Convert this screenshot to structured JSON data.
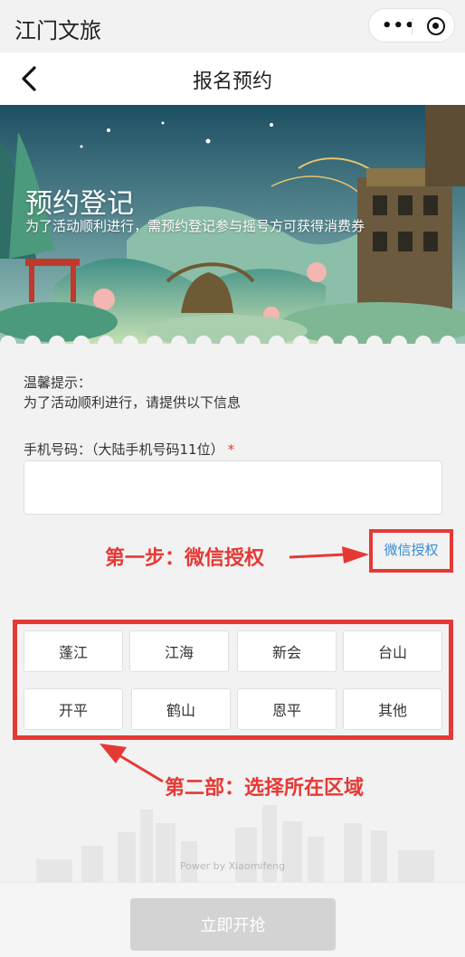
{
  "topbar": {
    "app_title": "江门文旅",
    "more_icon": "more-dots-icon",
    "close_icon": "target-icon"
  },
  "navbar": {
    "back_icon": "chevron-left-icon",
    "title": "报名预约"
  },
  "banner": {
    "title": "预约登记",
    "subtitle": "为了活动顺利进行，需预约登记参与摇号方可获得消费券"
  },
  "form": {
    "tip_title": "温馨提示：",
    "tip_text": "为了活动顺利进行，请提供以下信息",
    "phone_label": "手机号码：（大陆手机号码11位）",
    "required_mark": "*",
    "phone_value": "",
    "wechat_auth": "微信授权"
  },
  "annotations": {
    "step1": "第一步：微信授权",
    "step2": "第二部：选择所在区域"
  },
  "regions": [
    "蓬江",
    "江海",
    "新会",
    "台山",
    "开平",
    "鹤山",
    "恩平",
    "其他"
  ],
  "footer": {
    "powered_by": "Power by Xiaomifeng",
    "submit_label": "立即开抢"
  },
  "colors": {
    "annotation": "#e53935",
    "link": "#3a8bd1",
    "submit_disabled": "#d3d3d3"
  }
}
